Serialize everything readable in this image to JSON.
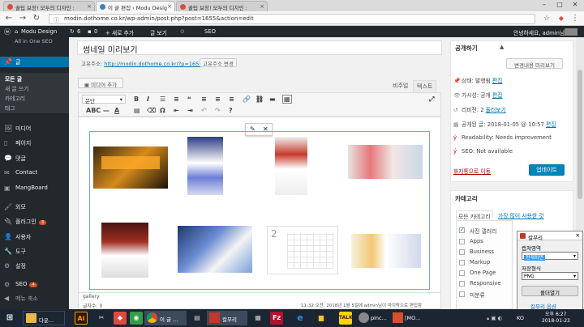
{
  "browser": {
    "tabs": [
      {
        "title": "꿀팁 보장! 모두의 디자인 :"
      },
      {
        "title": "이 글 편집 ‹ Modu Desig"
      },
      {
        "title": "꿀팁 보장! 모두의 디자인 :"
      }
    ],
    "url": "modin.dothome.co.kr/wp-admin/post.php?post=1655&action=edit",
    "icons": {
      "back": "←",
      "forward": "→",
      "reload": "↻"
    }
  },
  "adminbar": {
    "site": "Modu Design",
    "updates": "6",
    "comments": "0",
    "new": "+ 새로 추가",
    "view": "글 보기",
    "seo": "SEO",
    "greeting": "안녕하세요, admin님",
    "overlap": "All in One SEO"
  },
  "sidebar": {
    "items": [
      {
        "label": "글",
        "icon": "📌"
      },
      {
        "label": "미디어",
        "icon": "🖼"
      },
      {
        "label": "페이지",
        "icon": "▯"
      },
      {
        "label": "댓글",
        "icon": "💬"
      },
      {
        "label": "Contact",
        "icon": "✉"
      },
      {
        "label": "MangBoard",
        "icon": "▣"
      },
      {
        "label": "외모",
        "icon": "🖌"
      },
      {
        "label": "플러그인",
        "icon": "🔌",
        "badge": "3"
      },
      {
        "label": "사용자",
        "icon": "👤"
      },
      {
        "label": "도구",
        "icon": "🔧"
      },
      {
        "label": "설정",
        "icon": "⚙"
      },
      {
        "label": "SEO",
        "icon": "⚙",
        "badge": "4"
      },
      {
        "label": "메뉴 축소",
        "icon": "◀"
      }
    ],
    "submenu": [
      "모든 글",
      "새 글 쓰기",
      "카테고리",
      "태그"
    ]
  },
  "editor": {
    "title": "썸네일 미리보기",
    "permalink_label": "고유주소:",
    "permalink_url": "http://modin.dothome.co.kr/?p=1655",
    "permalink_button": "고유주소 변경",
    "add_media": "미디어 추가",
    "tab_visual": "비주얼",
    "tab_text": "텍스트",
    "format_select": "문단",
    "gallery_tag": "gallery",
    "wordcount": "글자수: 0",
    "last_edit": "11:32 오전, 2018년 1월 5일에 admin님이 마지막으로 편집함"
  },
  "publish": {
    "heading": "공개하기",
    "preview_btn": "변경내용 미리보기",
    "status_label": "상태: 발행됨",
    "visibility_label": "가시성: 공개",
    "revisions_label": "리비전: 2",
    "revisions_link": "둘러보기",
    "published_label": "공개된 글: 2018-01-05 @ 10:57",
    "edit": "편집",
    "readability": "Readability: Needs improvement",
    "seo": "SEO: Not available",
    "trash": "휴지통으로 이동",
    "update": "업데이트"
  },
  "categories": {
    "heading": "카테고리",
    "tab_all": "모든 카테고리",
    "tab_popular": "가장 많이 사용한 것",
    "items": [
      {
        "label": "사진 갤러리",
        "checked": true
      },
      {
        "label": "Apps",
        "checked": false
      },
      {
        "label": "Business",
        "checked": false
      },
      {
        "label": "Markup",
        "checked": false
      },
      {
        "label": "One Page",
        "checked": false
      },
      {
        "label": "Responsive",
        "checked": false
      },
      {
        "label": "미분류",
        "checked": false
      }
    ]
  },
  "capture": {
    "title": "칼무리",
    "area_label": "캡쳐영역",
    "area_value": "현재화면",
    "format_label": "저장형식",
    "format_value": "PNG",
    "open_button": "폴더열기",
    "footer": "칼무리 옵션"
  },
  "taskbar": {
    "items": [
      "다운...",
      "이 글 ...",
      "칼무리",
      "pinc...",
      "[MO..."
    ],
    "tray_lang": "KO",
    "time": "오후 6:27",
    "date": "2018-01-23"
  },
  "colors": {
    "wp_blue": "#0073aa",
    "admin_dark": "#23282d",
    "update": "#0085ba"
  }
}
